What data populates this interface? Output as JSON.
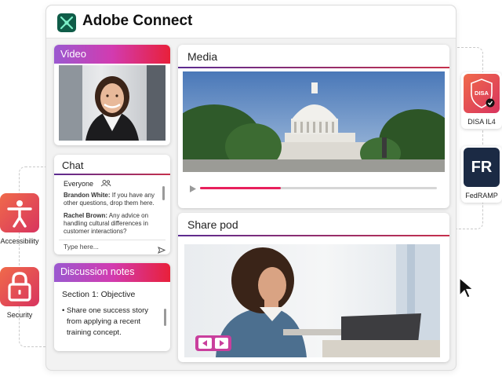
{
  "app": {
    "title": "Adobe Connect",
    "logo_icon": "adobe-connect-logo-icon"
  },
  "video_pod": {
    "title": "Video"
  },
  "chat_pod": {
    "title": "Chat",
    "audience": "Everyone",
    "messages": [
      {
        "sender": "Brandon White:",
        "text": " If you have any other questions, drop them here."
      },
      {
        "sender": "Rachel Brown:",
        "text": " Any advice on handling cultural differences in customer interactions?"
      }
    ],
    "input_placeholder": "Type here..."
  },
  "notes_pod": {
    "title": "Discussion notes",
    "section": "Section 1: Objective",
    "bullet": "Share one success story from applying a recent training concept."
  },
  "media_pod": {
    "title": "Media",
    "progress": 0.34
  },
  "share_pod": {
    "title": "Share pod"
  },
  "badges": {
    "accessibility": "Accessibility",
    "security": "Security",
    "disa": "DISA IL4",
    "disa_shield_text": "DISA",
    "fedramp": "FedRAMP",
    "fedramp_logo_text": "FR"
  },
  "colors": {
    "accent_purple": "#9b59d0",
    "accent_red": "#e8203a",
    "fedramp_navy": "#1b2a44"
  }
}
